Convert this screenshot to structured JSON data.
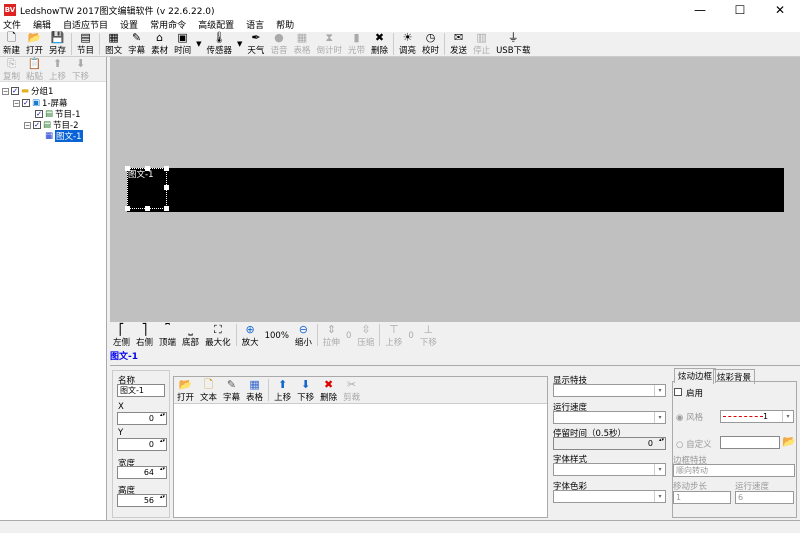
{
  "window": {
    "title": "LedshowTW 2017图文编辑软件 (v 22.6.22.0)",
    "minimize": "—",
    "maximize": "☐",
    "close": "✕"
  },
  "menu": [
    "文件",
    "编辑",
    "自适应节目",
    "设置",
    "常用命令",
    "高级配置",
    "语言",
    "帮助"
  ],
  "toolbar": [
    {
      "label": "新建",
      "icon": "new-file-icon",
      "glyph": "🗋"
    },
    {
      "label": "打开",
      "icon": "open-folder-icon",
      "glyph": "📂"
    },
    {
      "label": "另存",
      "icon": "save-icon",
      "glyph": "💾"
    },
    {
      "label": "节目",
      "icon": "program-icon",
      "glyph": "▤"
    },
    {
      "label": "图文",
      "icon": "picture-text-icon",
      "glyph": "▦"
    },
    {
      "label": "字幕",
      "icon": "subtitle-icon",
      "glyph": "✎"
    },
    {
      "label": "素材",
      "icon": "material-icon",
      "glyph": "⌂"
    },
    {
      "label": "时间",
      "icon": "clock-icon",
      "glyph": "▣"
    },
    {
      "label": "传感器",
      "icon": "thermometer-icon",
      "glyph": "🌡"
    },
    {
      "label": "天气",
      "icon": "weather-icon",
      "glyph": "✒"
    },
    {
      "label": "语音",
      "icon": "voice-icon",
      "glyph": "●",
      "disabled": true
    },
    {
      "label": "表格",
      "icon": "table-icon",
      "glyph": "▦",
      "disabled": true
    },
    {
      "label": "倒计时",
      "icon": "hourglass-icon",
      "glyph": "⧗",
      "disabled": true
    },
    {
      "label": "光带",
      "icon": "light-band-icon",
      "glyph": "▮",
      "disabled": true
    },
    {
      "label": "删除",
      "icon": "delete-icon",
      "glyph": "✖"
    },
    {
      "label": "调亮",
      "icon": "brightness-icon",
      "glyph": "☀"
    },
    {
      "label": "校时",
      "icon": "sync-time-icon",
      "glyph": "◷"
    },
    {
      "label": "发送",
      "icon": "send-icon",
      "glyph": "✉"
    },
    {
      "label": "停止",
      "icon": "stop-icon",
      "glyph": "▥",
      "disabled": true
    },
    {
      "label": "USB下载",
      "icon": "usb-icon",
      "glyph": "⏚"
    }
  ],
  "left_toolbar": [
    {
      "label": "复制",
      "glyph": "⎘"
    },
    {
      "label": "粘贴",
      "glyph": "📋"
    },
    {
      "label": "上移",
      "glyph": "⬆"
    },
    {
      "label": "下移",
      "glyph": "⬇"
    }
  ],
  "tree": {
    "group": "分组1",
    "screen": "1-屏幕",
    "programs": [
      "节目-1",
      "节目-2"
    ],
    "area": "图文-1"
  },
  "canvas": {
    "area_label": "图文-1",
    "screen_color": "#000000"
  },
  "bottom_toolbar": {
    "left": "左侧",
    "right": "右侧",
    "top": "顶端",
    "bottom": "底部",
    "maximize": "最大化",
    "zoom_in": "放大",
    "zoom": "100%",
    "zoom_out": "缩小",
    "stretch": "拉伸",
    "stretch_val": "0",
    "compress": "压缩",
    "up": "上移",
    "move_val": "0",
    "down": "下移"
  },
  "current_area": "图文-1",
  "props": {
    "name_label": "名称",
    "name_value": "图文-1",
    "x_label": "X",
    "x": "0",
    "y_label": "Y",
    "y": "0",
    "w_label": "宽度",
    "w": "64",
    "h_label": "高度",
    "h": "56"
  },
  "edit_toolbar": [
    "打开",
    "文本",
    "字幕",
    "表格",
    "上移",
    "下移",
    "删除",
    "剪裁"
  ],
  "effects": {
    "display_effect": "显示特技",
    "run_speed": "运行速度",
    "stay_time": "停留时间（0.5秒）",
    "stay_value": "0",
    "font_style": "字体样式",
    "font_color": "字体色彩"
  },
  "border": {
    "tab1": "炫动边框",
    "tab2": "炫彩背景",
    "enable": "启用",
    "style": "风格",
    "style_value": "1",
    "custom": "自定义",
    "effect_label": "边框特技",
    "effect_value": "顺向转动",
    "step_label": "移动步长",
    "step_value": "1",
    "speed_label": "运行速度",
    "speed_value": "6"
  }
}
